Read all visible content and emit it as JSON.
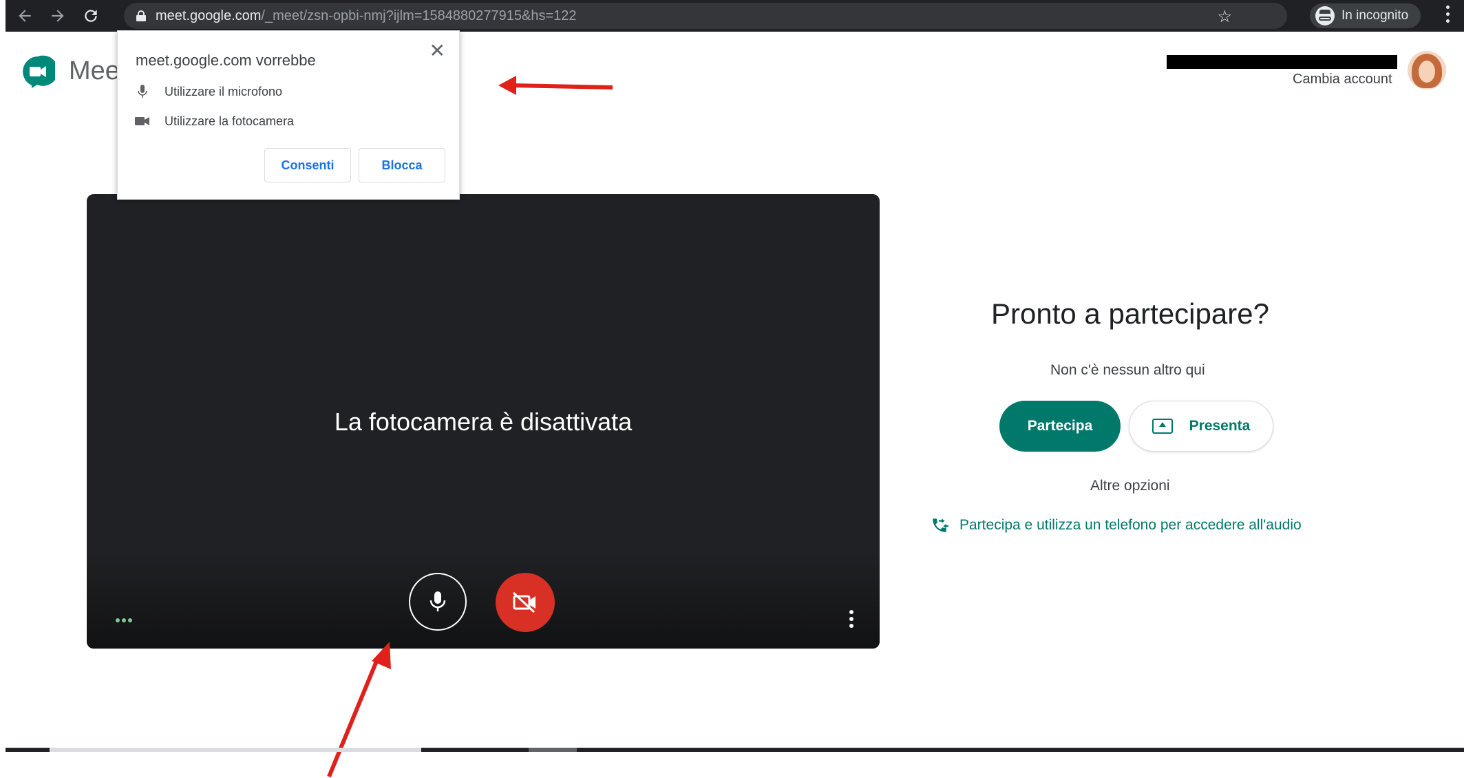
{
  "browser": {
    "url_host": "meet.google.com",
    "url_path": "/_meet/zsn-opbi-nmj?ijlm=1584880277915&hs=122",
    "incognito_label": "In incognito"
  },
  "header": {
    "app_title": "Mee",
    "switch_account": "Cambia account"
  },
  "permission_popup": {
    "title": "meet.google.com vorrebbe",
    "close": "✕",
    "mic_label": "Utilizzare il microfono",
    "camera_label": "Utilizzare la fotocamera",
    "allow_label": "Consenti",
    "block_label": "Blocca"
  },
  "preview": {
    "camera_off_text": "La fotocamera è disattivata"
  },
  "join_panel": {
    "title": "Pronto a partecipare?",
    "subtitle": "Non c'è nessun altro qui",
    "join_label": "Partecipa",
    "present_label": "Presenta",
    "other_options": "Altre opzioni",
    "phone_link": "Partecipa e utilizza un telefono per accedere all'audio"
  },
  "colors": {
    "accent": "#00796b",
    "camera_off": "#d93025",
    "annotation_arrow": "#e0201b"
  }
}
